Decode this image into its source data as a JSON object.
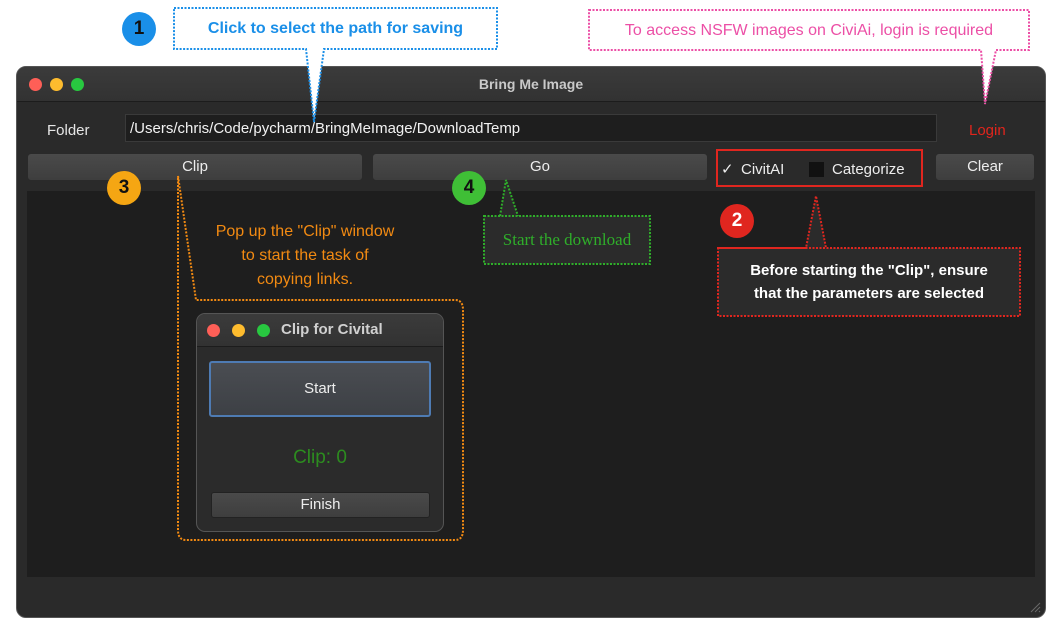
{
  "window": {
    "title": "Bring Me Image"
  },
  "toolbar": {
    "folder_label": "Folder",
    "folder_path": "/Users/chris/Code/pycharm/BringMeImage/DownloadTemp",
    "login_label": "Login",
    "clip_label": "Clip",
    "go_label": "Go",
    "civitai_label": "CivitAI",
    "civitai_checked": true,
    "check_mark": "✓",
    "categorize_label": "Categorize",
    "categorize_checked": false,
    "clear_label": "Clear"
  },
  "clip_window": {
    "title": "Clip for Civital",
    "start_label": "Start",
    "count_text": "Clip: 0",
    "finish_label": "Finish"
  },
  "annotations": {
    "step1": {
      "number": "1",
      "text": "Click to select the path for saving",
      "color": "#1a8fe8"
    },
    "nsfw": {
      "text": "To access NSFW images on CiviAi, login is required",
      "color": "#ec4fa6"
    },
    "step2": {
      "number": "2",
      "line1": "Before starting the \"Clip\", ensure",
      "line2": "that the parameters are selected",
      "color": "#e0261f"
    },
    "step3": {
      "number": "3",
      "line1": "Pop up the \"Clip\" window",
      "line2": "to start the task of",
      "line3": "copying links.",
      "color": "#f28a12"
    },
    "step4": {
      "number": "4",
      "text": "Start the download",
      "color": "#2fae2a"
    }
  }
}
